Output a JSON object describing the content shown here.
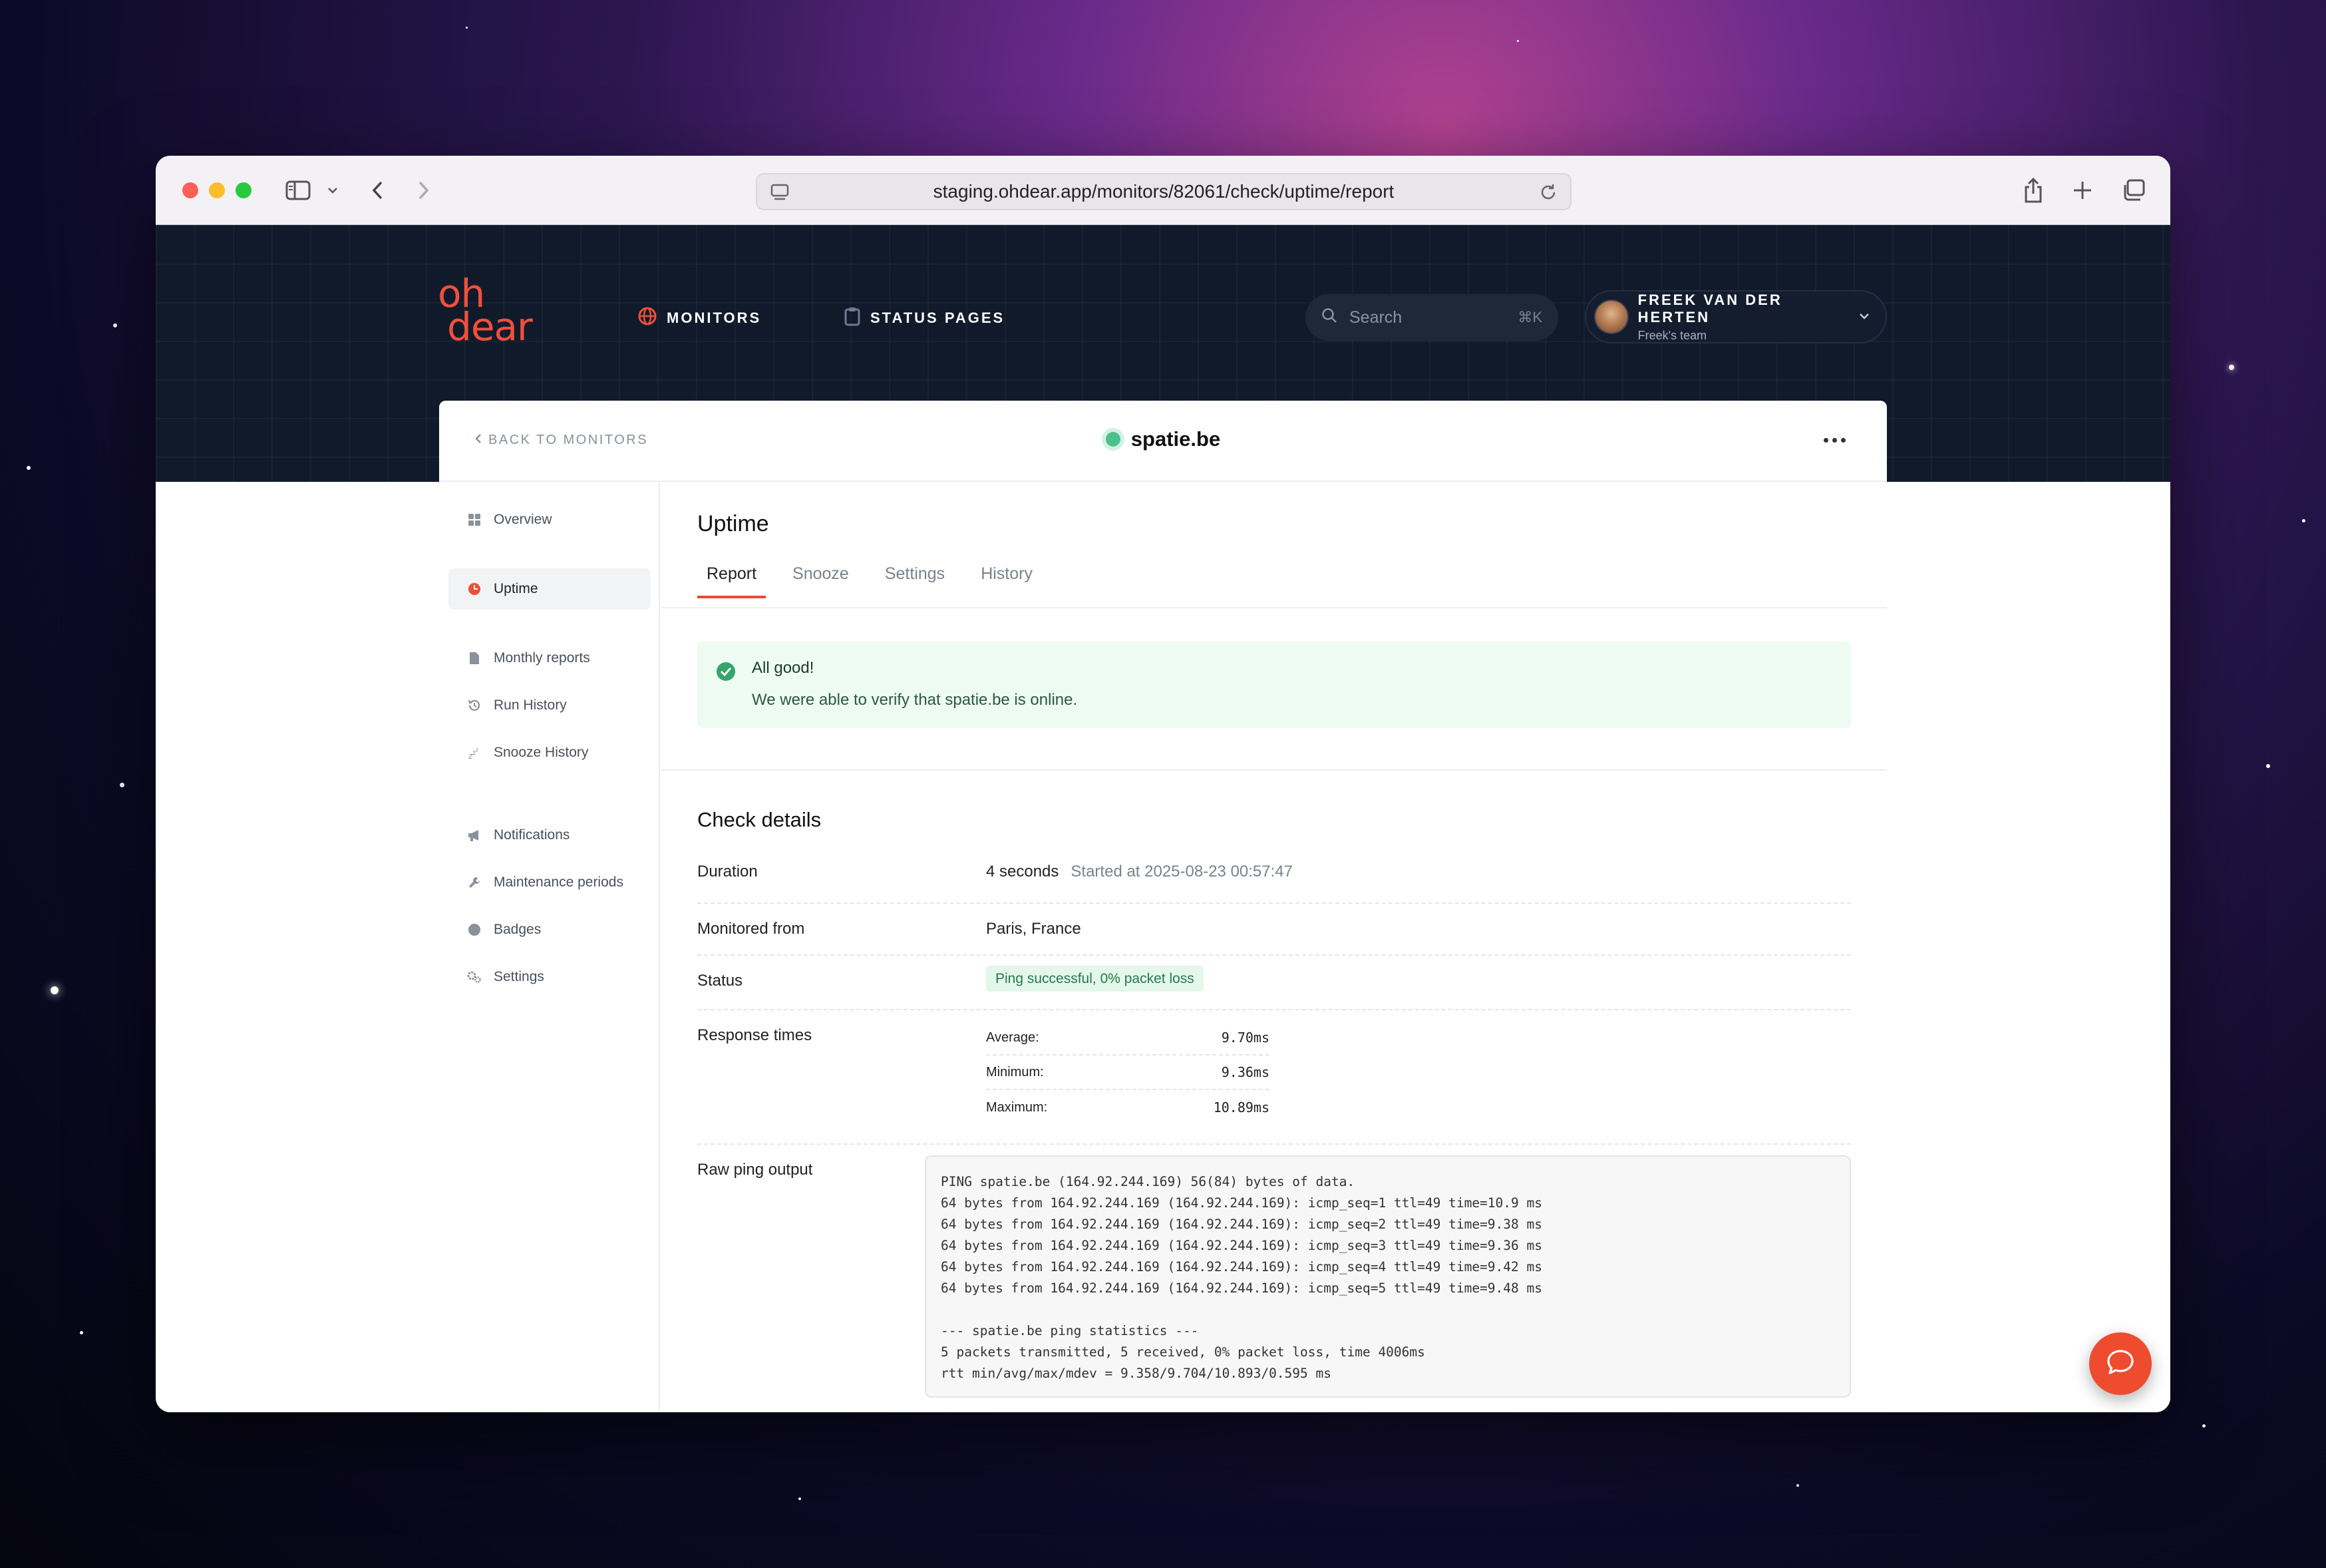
{
  "browser": {
    "url": "staging.ohdear.app/monitors/82061/check/uptime/report"
  },
  "header": {
    "logo_line1": "oh",
    "logo_line2": "dear",
    "nav": [
      {
        "label": "MONITORS",
        "icon": "globe-icon"
      },
      {
        "label": "STATUS PAGES",
        "icon": "clipboard-icon"
      }
    ],
    "search": {
      "placeholder": "Search",
      "shortcut": "⌘K"
    },
    "user": {
      "name": "FREEK VAN DER HERTEN",
      "team": "Freek's team"
    }
  },
  "card": {
    "back_label": "BACK TO MONITORS",
    "site_name": "spatie.be"
  },
  "sidebar": {
    "items": [
      {
        "label": "Overview",
        "icon": "grid-icon"
      },
      {
        "label": "Uptime",
        "icon": "uptime-icon"
      },
      {
        "label": "Monthly reports",
        "icon": "document-icon"
      },
      {
        "label": "Run History",
        "icon": "history-icon"
      },
      {
        "label": "Snooze History",
        "icon": "snooze-icon"
      },
      {
        "label": "Notifications",
        "icon": "megaphone-icon"
      },
      {
        "label": "Maintenance periods",
        "icon": "wrench-icon"
      },
      {
        "label": "Badges",
        "icon": "badge-icon"
      },
      {
        "label": "Settings",
        "icon": "gear-icon"
      }
    ]
  },
  "main": {
    "title": "Uptime",
    "tabs": [
      "Report",
      "Snooze",
      "Settings",
      "History"
    ],
    "alert": {
      "title": "All good!",
      "body": "We were able to verify that spatie.be is online."
    },
    "details_title": "Check details",
    "duration_label": "Duration",
    "duration_value": "4 seconds",
    "duration_started": "Started at 2025-08-23 00:57:47",
    "monitored_label": "Monitored from",
    "monitored_value": "Paris, France",
    "status_label": "Status",
    "status_value": "Ping successful, 0% packet loss",
    "response_label": "Response times",
    "response_times": [
      {
        "label": "Average:",
        "value": "9.70ms"
      },
      {
        "label": "Minimum:",
        "value": "9.36ms"
      },
      {
        "label": "Maximum:",
        "value": "10.89ms"
      }
    ],
    "raw_label": "Raw ping output",
    "raw_output": "PING spatie.be (164.92.244.169) 56(84) bytes of data.\n64 bytes from 164.92.244.169 (164.92.244.169): icmp_seq=1 ttl=49 time=10.9 ms\n64 bytes from 164.92.244.169 (164.92.244.169): icmp_seq=2 ttl=49 time=9.38 ms\n64 bytes from 164.92.244.169 (164.92.244.169): icmp_seq=3 ttl=49 time=9.36 ms\n64 bytes from 164.92.244.169 (164.92.244.169): icmp_seq=4 ttl=49 time=9.42 ms\n64 bytes from 164.92.244.169 (164.92.244.169): icmp_seq=5 ttl=49 time=9.48 ms\n\n--- spatie.be ping statistics ---\n5 packets transmitted, 5 received, 0% packet loss, time 4006ms\nrtt min/avg/max/mdev = 9.358/9.704/10.893/0.595 ms"
  },
  "colors": {
    "accent": "#e94a35",
    "header_bg": "#111a2b",
    "success_bg": "#edfbf2",
    "success_dot": "#4fc08d"
  }
}
